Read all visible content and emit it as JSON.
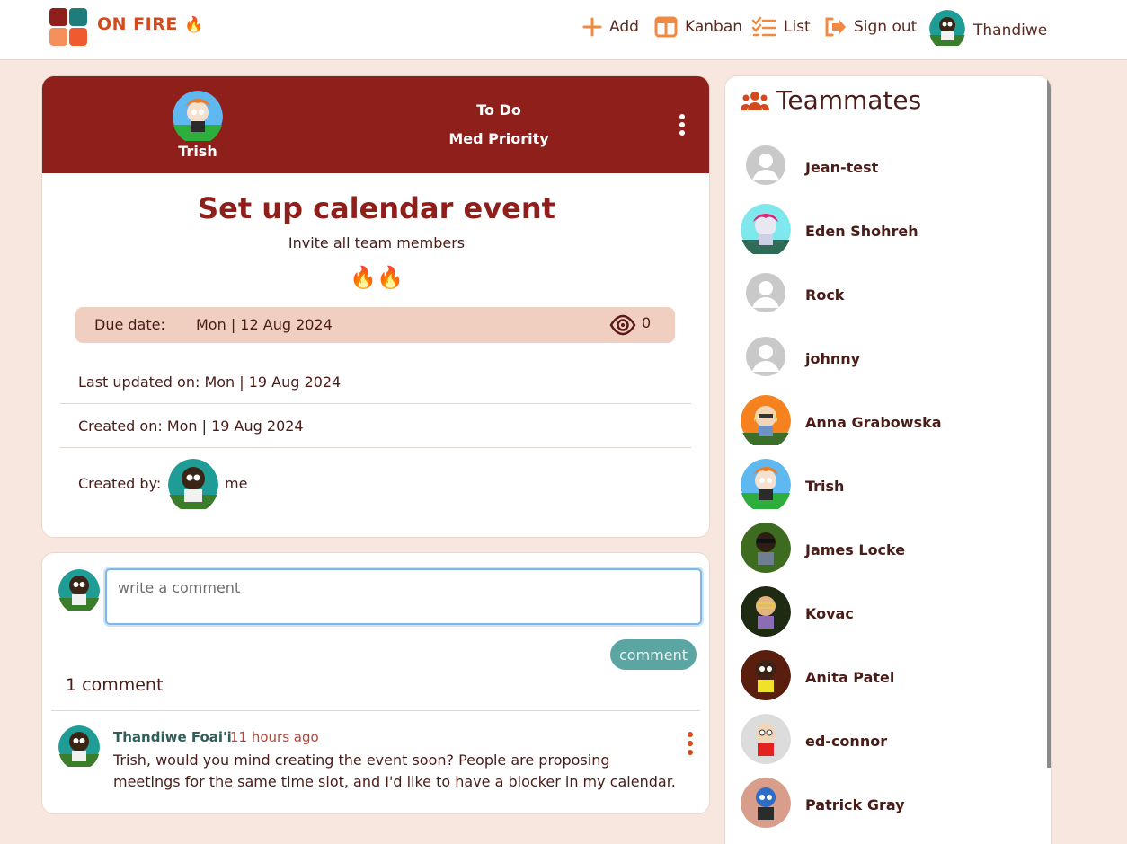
{
  "header": {
    "brand": "ON FIRE",
    "brand_emoji": "🔥",
    "nav": [
      {
        "label": "Add",
        "icon": "plus-icon"
      },
      {
        "label": "Kanban",
        "icon": "kanban-icon"
      },
      {
        "label": "List",
        "icon": "list-icon"
      },
      {
        "label": "Sign out",
        "icon": "sign-out-icon"
      }
    ],
    "user_name": "Thandiwe"
  },
  "task": {
    "assignee": "Trish",
    "status": "To Do",
    "priority": "Med Priority",
    "title": "Set up calendar event",
    "description": "Invite all team members",
    "flames": "🔥🔥",
    "due_label": "Due date:",
    "due_date": "Mon | 12 Aug 2024",
    "watchers": "0",
    "last_updated": "Last updated on: Mon | 19 Aug 2024",
    "created_on": "Created on: Mon | 19 Aug 2024",
    "created_by_label": "Created by:",
    "created_by": "me"
  },
  "comments": {
    "placeholder": "write a comment",
    "button": "comment",
    "count_label": "1 comment",
    "items": [
      {
        "author": "Thandiwe Foai'i",
        "time": "11 hours ago",
        "text": "Trish, would you mind creating the event soon? People are proposing meetings for the same time slot, and I'd like to have a blocker in my calendar."
      }
    ]
  },
  "teammates": {
    "title": "Teammates",
    "members": [
      {
        "name": "Jean-test"
      },
      {
        "name": "Eden Shohreh"
      },
      {
        "name": "Rock"
      },
      {
        "name": "johnny"
      },
      {
        "name": "Anna Grabowska"
      },
      {
        "name": "Trish"
      },
      {
        "name": "James Locke"
      },
      {
        "name": "Kovac"
      },
      {
        "name": "Anita Patel"
      },
      {
        "name": "ed-connor"
      },
      {
        "name": "Patrick Gray"
      }
    ]
  },
  "colors": {
    "brand": "#d34a1f",
    "header_bar": "#8e1f1b",
    "accent_orange": "#f08a43",
    "comment_button": "#5ba5a2",
    "page_bg": "#f7e7de",
    "due_bg": "#f0cfc1"
  }
}
